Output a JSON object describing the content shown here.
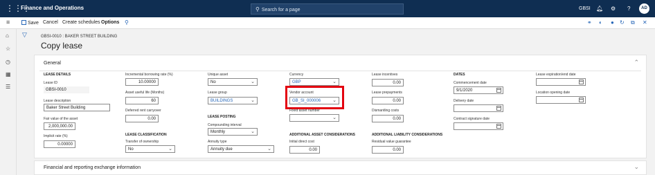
{
  "app": {
    "waffle_icon": "waffle-icon",
    "title": "Finance and Operations",
    "search_placeholder": "Search for a page",
    "company": "GBSI",
    "avatar": "AD"
  },
  "actionbar": {
    "save": "Save",
    "cancel": "Cancel",
    "create_schedules": "Create schedules",
    "options": "Options"
  },
  "breadcrumb": "GBSI-0010 : BAKER STREET BUILDING",
  "page_title": "Copy lease",
  "general": {
    "title": "General",
    "lease_details_header": "LEASE DETAILS",
    "lease_id_label": "Lease ID",
    "lease_id": "GBSI-0010",
    "lease_description_label": "Lease description",
    "lease_description": "Baker Street Building",
    "fair_value_label": "Fair value of the asset",
    "fair_value": "2,000,000.00",
    "implicit_rate_label": "Implicit rate (%)",
    "implicit_rate": "0.00000",
    "ibr_label": "Incremental borrowing rate (%)",
    "ibr": "10.00000",
    "useful_life_label": "Asset useful life (Months)",
    "useful_life": "60",
    "deferred_rent_label": "Deferred rent carryover",
    "deferred_rent": "0.00",
    "lease_classification_header": "LEASE CLASSIFICATION",
    "transfer_ownership_label": "Transfer of ownership",
    "transfer_ownership": "No",
    "unique_asset_label": "Unique asset",
    "unique_asset": "No",
    "lease_group_label": "Lease group",
    "lease_group": "BUILDINGS",
    "lease_posting_header": "LEASE POSTING",
    "compounding_label": "Compounding interval",
    "compounding": "Monthly",
    "annuity_type_label": "Annuity type",
    "annuity_type": "Annuity due",
    "currency_label": "Currency",
    "currency": "GBP",
    "vendor_account_label": "Vendor account",
    "vendor_account": "GB_SI_000006",
    "fixed_asset_label": "Fixed asset number",
    "fixed_asset": "",
    "addl_asset_header": "ADDITIONAL ASSET CONSIDERATIONS",
    "initial_direct_cost_label": "Initial direct cost",
    "initial_direct_cost": "0.00",
    "lease_incentives_label": "Lease incentives",
    "lease_incentives": "0.00",
    "lease_prepayments_label": "Lease prepayments",
    "lease_prepayments": "0.00",
    "dismantling_label": "Dismantling costs",
    "dismantling": "0.00",
    "addl_liability_header": "ADDITIONAL LIABILITY CONSIDERATIONS",
    "residual_value_label": "Residual value guarantee",
    "residual_value": "0.00",
    "dates_header": "DATES",
    "commencement_label": "Commencement date",
    "commencement": "9/1/2020",
    "delivery_label": "Delivery date",
    "delivery": "",
    "contract_signature_label": "Contract signature date",
    "contract_signature": "",
    "expiration_label": "Lease expiration/end date",
    "expiration": "",
    "location_opening_label": "Location opening date",
    "location_opening": ""
  },
  "financial_panel_title": "Financial and reporting exchange information",
  "colors": {
    "topbar": "#0f2e52",
    "accent": "#2666b7",
    "highlight": "#e3000f"
  }
}
